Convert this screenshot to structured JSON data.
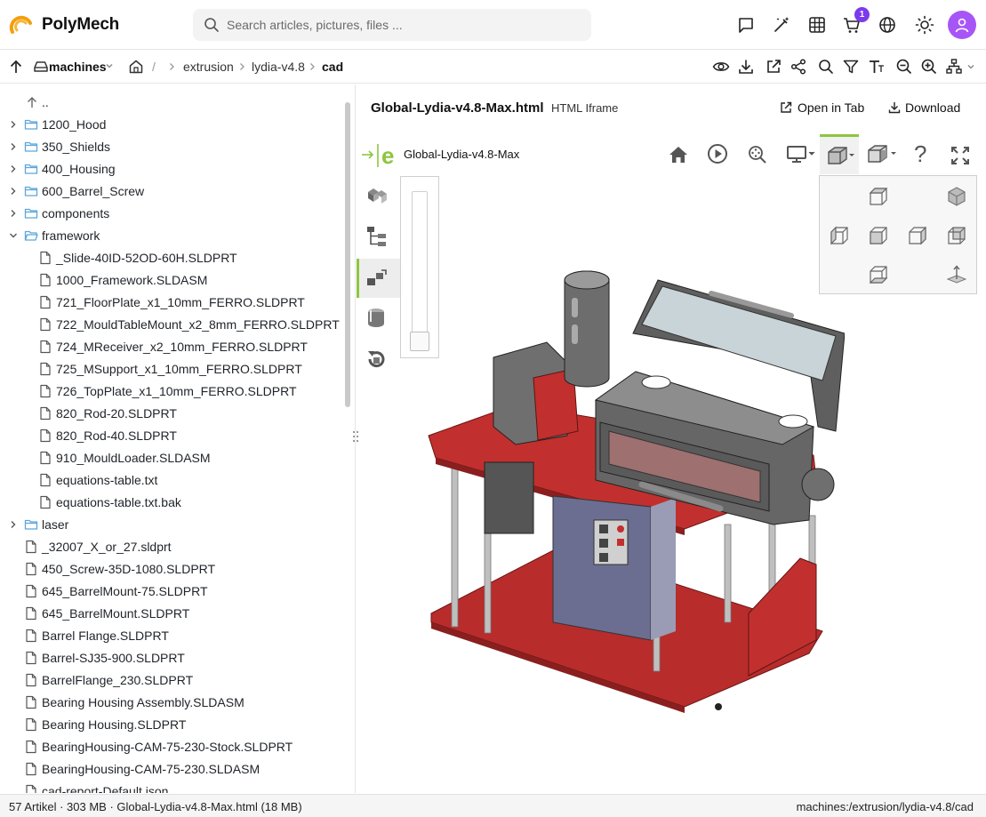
{
  "app": {
    "name": "PolyMech"
  },
  "search": {
    "placeholder": "Search articles, pictures, files ..."
  },
  "header": {
    "icons": [
      "chat-icon",
      "magic-wand-icon",
      "grid-icon",
      "cart-icon",
      "globe-icon",
      "theme-icon"
    ],
    "cart_badge": "1",
    "avatar": "user-icon"
  },
  "breadcrumb": {
    "root": "machines",
    "separator": "/",
    "items": [
      "extrusion",
      "lydia-v4.8",
      "cad"
    ]
  },
  "sidebar": {
    "up": "..",
    "rows": [
      {
        "label": "1200_Hood",
        "type": "folder"
      },
      {
        "label": "350_Shields",
        "type": "folder"
      },
      {
        "label": "400_Housing",
        "type": "folder"
      },
      {
        "label": "600_Barrel_Screw",
        "type": "folder"
      },
      {
        "label": "components",
        "type": "folder"
      },
      {
        "label": "framework",
        "type": "folder-open"
      },
      {
        "label": "_Slide-40ID-52OD-60H.SLDPRT",
        "type": "file"
      },
      {
        "label": "1000_Framework.SLDASM",
        "type": "file"
      },
      {
        "label": "721_FloorPlate_x1_10mm_FERRO.SLDPRT",
        "type": "file"
      },
      {
        "label": "722_MouldTableMount_x2_8mm_FERRO.SLDPRT",
        "type": "file"
      },
      {
        "label": "724_MReceiver_x2_10mm_FERRO.SLDPRT",
        "type": "file"
      },
      {
        "label": "725_MSupport_x1_10mm_FERRO.SLDPRT",
        "type": "file"
      },
      {
        "label": "726_TopPlate_x1_10mm_FERRO.SLDPRT",
        "type": "file"
      },
      {
        "label": "820_Rod-20.SLDPRT",
        "type": "file"
      },
      {
        "label": "820_Rod-40.SLDPRT",
        "type": "file"
      },
      {
        "label": "910_MouldLoader.SLDASM",
        "type": "file"
      },
      {
        "label": "equations-table.txt",
        "type": "file"
      },
      {
        "label": "equations-table.txt.bak",
        "type": "file"
      },
      {
        "label": "laser",
        "type": "folder"
      },
      {
        "label": "_32007_X_or_27.sldprt",
        "type": "file"
      },
      {
        "label": "450_Screw-35D-1080.SLDPRT",
        "type": "file"
      },
      {
        "label": "645_BarrelMount-75.SLDPRT",
        "type": "file"
      },
      {
        "label": "645_BarrelMount.SLDPRT",
        "type": "file"
      },
      {
        "label": "Barrel Flange.SLDPRT",
        "type": "file"
      },
      {
        "label": "Barrel-SJ35-900.SLDPRT",
        "type": "file"
      },
      {
        "label": "BarrelFlange_230.SLDPRT",
        "type": "file"
      },
      {
        "label": "Bearing Housing Assembly.SLDASM",
        "type": "file"
      },
      {
        "label": "Bearing Housing.SLDPRT",
        "type": "file"
      },
      {
        "label": "BearingHousing-CAM-75-230-Stock.SLDPRT",
        "type": "file"
      },
      {
        "label": "BearingHousing-CAM-75-230.SLDASM",
        "type": "file"
      },
      {
        "label": "cad-report-Default.json",
        "type": "file"
      }
    ]
  },
  "content": {
    "title": "Global-Lydia-v4.8-Max.html",
    "type": "HTML Iframe",
    "open_tab": "Open in Tab",
    "download": "Download"
  },
  "viewer": {
    "name": "Global-Lydia-v4.8-Max",
    "logo_letter": "e",
    "help": "?"
  },
  "status": {
    "left": "57 Artikel · 303 MB · Global-Lydia-v4.8-Max.html (18 MB)",
    "right": "machines:/extrusion/lydia-v4.8/cad"
  },
  "colors": {
    "accent": "#8dc63f",
    "avatar": "#a855f7",
    "badge": "#7c3aed",
    "logo": "#f59e0b",
    "table_red": "#b82c2c",
    "folder": "#5aa6dc"
  }
}
